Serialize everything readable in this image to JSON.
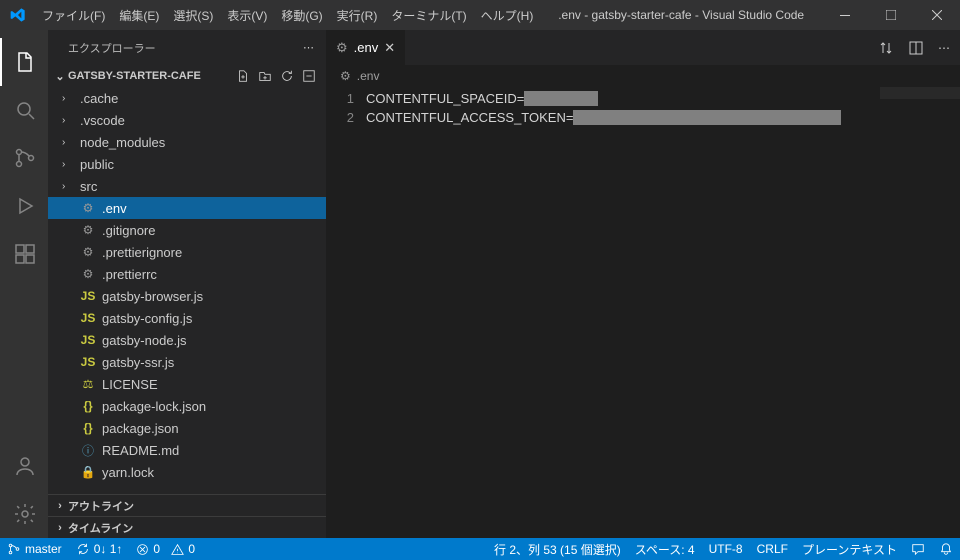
{
  "title": ".env - gatsby-starter-cafe - Visual Studio Code",
  "menu": [
    "ファイル(F)",
    "編集(E)",
    "選択(S)",
    "表示(V)",
    "移動(G)",
    "実行(R)",
    "ターミナル(T)",
    "ヘルプ(H)"
  ],
  "sidebar": {
    "title": "エクスプローラー",
    "project": "GATSBY-STARTER-CAFE",
    "folders": [
      ".cache",
      ".vscode",
      "node_modules",
      "public",
      "src"
    ],
    "files": [
      {
        "icon": "gear",
        "name": ".env"
      },
      {
        "icon": "gear",
        "name": ".gitignore"
      },
      {
        "icon": "gear",
        "name": ".prettierignore"
      },
      {
        "icon": "gear",
        "name": ".prettierrc"
      },
      {
        "icon": "js",
        "name": "gatsby-browser.js"
      },
      {
        "icon": "js",
        "name": "gatsby-config.js"
      },
      {
        "icon": "js",
        "name": "gatsby-node.js"
      },
      {
        "icon": "js",
        "name": "gatsby-ssr.js"
      },
      {
        "icon": "lic",
        "name": "LICENSE"
      },
      {
        "icon": "brace",
        "name": "package-lock.json"
      },
      {
        "icon": "brace",
        "name": "package.json"
      },
      {
        "icon": "info",
        "name": "README.md"
      },
      {
        "icon": "lock",
        "name": "yarn.lock"
      }
    ],
    "selected": ".env",
    "bottom": [
      "アウトライン",
      "タイムライン"
    ]
  },
  "tab": {
    "name": ".env"
  },
  "breadcrumb": ".env",
  "editor": {
    "lines": [
      {
        "n": "1",
        "text": "CONTENTFUL_SPACEID=",
        "selw": 74
      },
      {
        "n": "2",
        "text": "CONTENTFUL_ACCESS_TOKEN=",
        "selw": 268
      }
    ]
  },
  "status": {
    "branch": "master",
    "sync": "0↓ 1↑",
    "problems": "0  0",
    "pos": "行 2、列 53 (15 個選択)",
    "spaces": "スペース: 4",
    "enc": "UTF-8",
    "eol": "CRLF",
    "lang": "プレーンテキスト"
  }
}
